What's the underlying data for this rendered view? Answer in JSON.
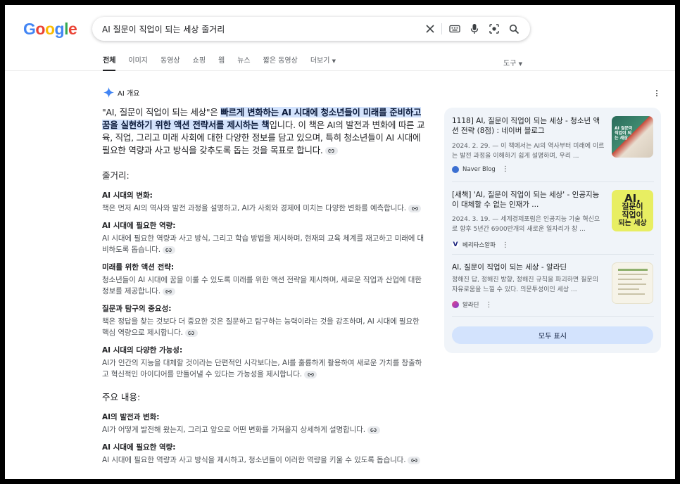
{
  "search": {
    "query": "AI 질문이 직업이 되는 세상 줄거리"
  },
  "tabs": [
    "전체",
    "이미지",
    "동영상",
    "쇼핑",
    "웹",
    "뉴스",
    "짧은 동영상",
    "더보기"
  ],
  "tools_label": "도구",
  "ai_overview": {
    "label": "AI 개요",
    "intro_prefix": "\"AI, 질문이 직업이 되는 세상\"은 ",
    "intro_highlight": "빠르게 변화하는 AI 시대에 청소년들이 미래를 준비하고 꿈을 실현하기 위한 액션 전략서를 제시하는 책",
    "intro_suffix": "입니다. 이 책은 AI의 발전과 변화에 따른 교육, 직업, 그리고 미래 사회에 대한 다양한 정보를 담고 있으며, 특히 청소년들이 AI 시대에 필요한 역량과 사고 방식을 갖추도록 돕는 것을 목표로 합니다.",
    "section1_title": "줄거리:",
    "section1_items": [
      {
        "title": "AI 시대의 변화:",
        "body": "책은 먼저 AI의 역사와 발전 과정을 설명하고, AI가 사회와 경제에 미치는 다양한 변화를 예측합니다."
      },
      {
        "title": "AI 시대에 필요한 역량:",
        "body": "AI 시대에 필요한 역량과 사고 방식, 그리고 학습 방법을 제시하며, 현재의 교육 체계를 재고하고 미래에 대비하도록 돕습니다."
      },
      {
        "title": "미래를 위한 액션 전략:",
        "body": "청소년들이 AI 시대에 꿈을 이룰 수 있도록 미래를 위한 액션 전략을 제시하며, 새로운 직업과 산업에 대한 정보를 제공합니다."
      },
      {
        "title": "질문과 탐구의 중요성:",
        "body": "책은 정답을 찾는 것보다 더 중요한 것은 질문하고 탐구하는 능력이라는 것을 강조하며, AI 시대에 필요한 핵심 역량으로 제시합니다."
      },
      {
        "title": "AI 시대의 다양한 가능성:",
        "body": "AI가 인간의 지능을 대체할 것이라는 단편적인 시각보다는, AI를 훌륭하게 활용하여 새로운 가치를 창출하고 혁신적인 아이디어를 만들어낼 수 있다는 가능성을 제시합니다."
      }
    ],
    "section2_title": "주요 내용:",
    "section2_items": [
      {
        "title": "AI의 발전과 변화:",
        "body": "AI가 어떻게 발전해 왔는지, 그리고 앞으로 어떤 변화를 가져올지 상세하게 설명합니다."
      },
      {
        "title": "AI 시대에 필요한 역량:",
        "body": "AI 시대에 필요한 역량과 사고 방식을 제시하고, 청소년들이 이러한 역량을 키울 수 있도록 돕습니다."
      }
    ]
  },
  "sources": [
    {
      "title": "1118] AI, 질문이 직업이 되는 세상 - 청소년 액션 전략 (8점) : 네이버 블로그",
      "desc": "2024. 2. 29. — 이 책에서는 AI의 역사부터 미래에 이르는 발전 과정을 이해하기 쉽게 설명하며, 우리 ...",
      "site": "Naver Blog",
      "favicon_color": "#3b6fd1",
      "favicon_glyph": "◐"
    },
    {
      "title": "[새책] 'AI, 질문이 직업이 되는 세상' - 인공지능이 대체할 수 없는 인재가 ...",
      "desc": "2024. 3. 19. — 세계경제포럼은 인공지능 기술 혁신으로 향후 5년간 6900만개의 새로운 일자리가 창 ...",
      "site": "베리타스알파",
      "favicon_color": "#ffffff",
      "favicon_glyph": "V"
    },
    {
      "title": "AI, 질문이 직업이 되는 세상 - 알라딘",
      "desc": "정해진 답, 정해진 방향, 정해진 규칙을 파괴하면 질문의 자유로움을 느낄 수 있다. 의문투성이인 세상 ...",
      "site": "알라딘",
      "favicon_color": "#d13b8a",
      "favicon_glyph": "◉"
    }
  ],
  "thumb_text": {
    "t1": "AI 질문이 직업이 되는 세상",
    "t2a": "AI,",
    "t2b": "질문이",
    "t2c": "직업이",
    "t2d": "되는 세상"
  },
  "show_all_label": "모두 표시",
  "colors": {
    "accent_blue": "#1a73e8",
    "highlight": "#d3e3fd",
    "panel_bg": "#f0f4f9"
  }
}
